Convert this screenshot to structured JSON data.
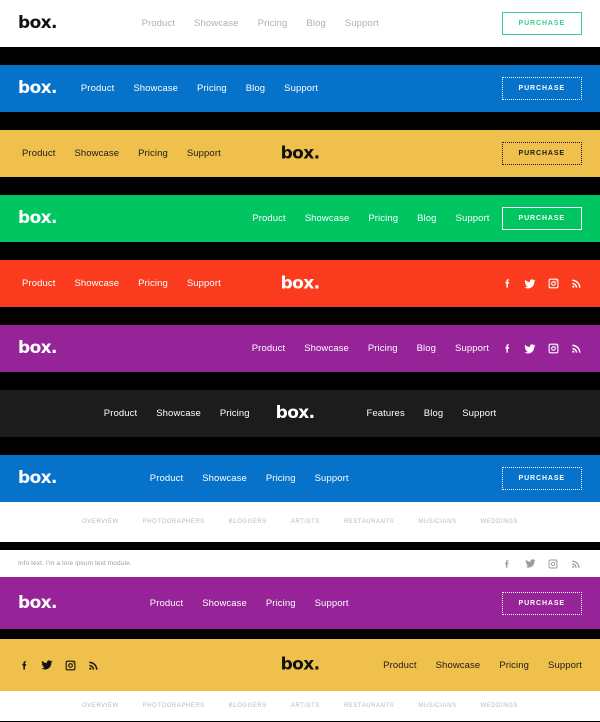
{
  "brand": {
    "logo": "box."
  },
  "labels": {
    "product": "Product",
    "showcase": "Showcase",
    "pricing": "Pricing",
    "blog": "Blog",
    "support": "Support",
    "features": "Features",
    "purchase": "PURCHASE"
  },
  "colors": {
    "white": "#ffffff",
    "black": "#000000",
    "dark": "#1c1c1c",
    "blue": "#0672c9",
    "yellow": "#f0c04c",
    "green": "#00c561",
    "red": "#fb3b1e",
    "purple": "#962398",
    "accent_green": "#3ecf8e",
    "muted_grey": "#b0b0b0"
  },
  "social": [
    {
      "name": "facebook-icon",
      "label": "Facebook"
    },
    {
      "name": "twitter-icon",
      "label": "Twitter"
    },
    {
      "name": "instagram-icon",
      "label": "Instagram"
    },
    {
      "name": "rss-icon",
      "label": "RSS"
    }
  ],
  "subnav": {
    "items": [
      "OVERVIEW",
      "PHOTOGRAPHERS",
      "BLOGGERS",
      "ARTISTS",
      "RESTAURANTS",
      "MUSICIANS",
      "WEDDINGS"
    ]
  },
  "info": {
    "text": "Info text. I'm a lore ipsum text module."
  },
  "bars": [
    {
      "id": "bar-white",
      "background": "#ffffff",
      "text_color": "#b0b0b0",
      "logo_color": "#111111",
      "button_color": "#3ecf8e",
      "layout": "logo-left-nav-center-button-right",
      "nav": [
        "Product",
        "Showcase",
        "Pricing",
        "Blog",
        "Support"
      ],
      "button": "PURCHASE"
    },
    {
      "id": "bar-blue",
      "background": "#0672c9",
      "text_color": "#ffffff",
      "logo_color": "#ffffff",
      "button_color": "#ffffff",
      "layout": "logo-left-nav-left-button-right",
      "nav": [
        "Product",
        "Showcase",
        "Pricing",
        "Blog",
        "Support"
      ],
      "button": "PURCHASE"
    },
    {
      "id": "bar-yellow",
      "background": "#f0c04c",
      "text_color": "#1a1a1a",
      "logo_color": "#111111",
      "button_color": "#1a1a1a",
      "layout": "nav-left-logo-center-button-right",
      "nav": [
        "Product",
        "Showcase",
        "Pricing",
        "Support"
      ],
      "button": "PURCHASE"
    },
    {
      "id": "bar-green",
      "background": "#00c561",
      "text_color": "#ffffff",
      "logo_color": "#ffffff",
      "button_color": "#ffffff",
      "layout": "logo-left-nav-right-button-right",
      "nav": [
        "Product",
        "Showcase",
        "Pricing",
        "Blog",
        "Support"
      ],
      "button": "PURCHASE"
    },
    {
      "id": "bar-red",
      "background": "#fb3b1e",
      "text_color": "#ffffff",
      "logo_color": "#ffffff",
      "layout": "nav-left-logo-center-social-right",
      "nav": [
        "Product",
        "Showcase",
        "Pricing",
        "Support"
      ]
    },
    {
      "id": "bar-purple",
      "background": "#962398",
      "text_color": "#ffffff",
      "logo_color": "#ffffff",
      "layout": "logo-left-nav-right-social-right",
      "nav": [
        "Product",
        "Showcase",
        "Pricing",
        "Blog",
        "Support"
      ]
    },
    {
      "id": "bar-dark",
      "background": "#1c1c1c",
      "text_color": "#ffffff",
      "logo_color": "#ffffff",
      "layout": "split-nav-center-logo",
      "nav_left": [
        "Product",
        "Showcase",
        "Pricing"
      ],
      "nav_right": [
        "Features",
        "Blog",
        "Support"
      ]
    },
    {
      "id": "bar-blue-subnav",
      "background": "#0672c9",
      "text_color": "#ffffff",
      "logo_color": "#ffffff",
      "button_color": "#ffffff",
      "layout": "logo-left-nav-center-button-right-with-subnav",
      "nav": [
        "Product",
        "Showcase",
        "Pricing",
        "Support"
      ],
      "button": "PURCHASE"
    },
    {
      "id": "bar-info-purple",
      "background": "#962398",
      "text_color": "#ffffff",
      "logo_color": "#ffffff",
      "button_color": "#ffffff",
      "layout": "infobar-above-logo-left-nav-center-button-right",
      "nav": [
        "Product",
        "Showcase",
        "Pricing",
        "Support"
      ],
      "button": "PURCHASE"
    },
    {
      "id": "bar-yellow-social",
      "background": "#f0c04c",
      "text_color": "#1a1a1a",
      "logo_color": "#111111",
      "layout": "social-left-logo-center-nav-right-with-subnav",
      "nav": [
        "Product",
        "Showcase",
        "Pricing",
        "Support"
      ]
    }
  ]
}
